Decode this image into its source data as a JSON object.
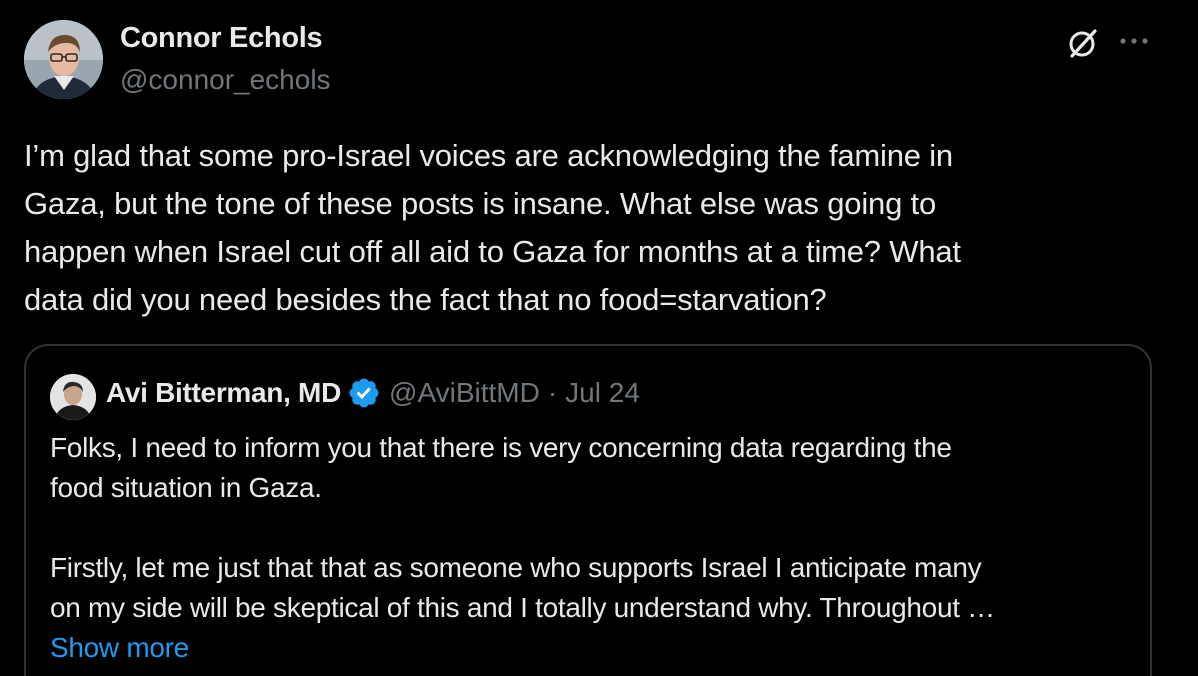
{
  "post": {
    "author": {
      "name": "Connor Echols",
      "handle": "@connor_echols"
    },
    "text": "I’m glad that some pro-Israel voices are acknowledging the famine in\nGaza, but the tone of these posts is insane. What else was going to\nhappen when Israel cut off all aid to Gaza for months at a time? What\ndata did you need besides the fact that no food=starvation?",
    "icons": {
      "grok": "grok-icon",
      "more": "more-icon"
    },
    "more_label": "···"
  },
  "quote": {
    "author": {
      "name": "Avi Bitterman, MD",
      "handle": "@AviBittMD",
      "separator": "·",
      "date": "Jul 24",
      "verified_icon": "verified-badge-icon"
    },
    "paragraph1": "Folks, I need to inform you that there is very concerning data regarding the\nfood situation in Gaza.",
    "paragraph2": "Firstly, let me just that that as someone who supports Israel I anticipate many\non my side will be skeptical of this and I totally understand why. Throughout …",
    "show_more": "Show more"
  },
  "colors": {
    "background": "#000000",
    "text": "#e7e9ea",
    "secondary": "#71767b",
    "border": "#2f3336",
    "link": "#1d9bf0",
    "verified": "#1d9bf0"
  }
}
